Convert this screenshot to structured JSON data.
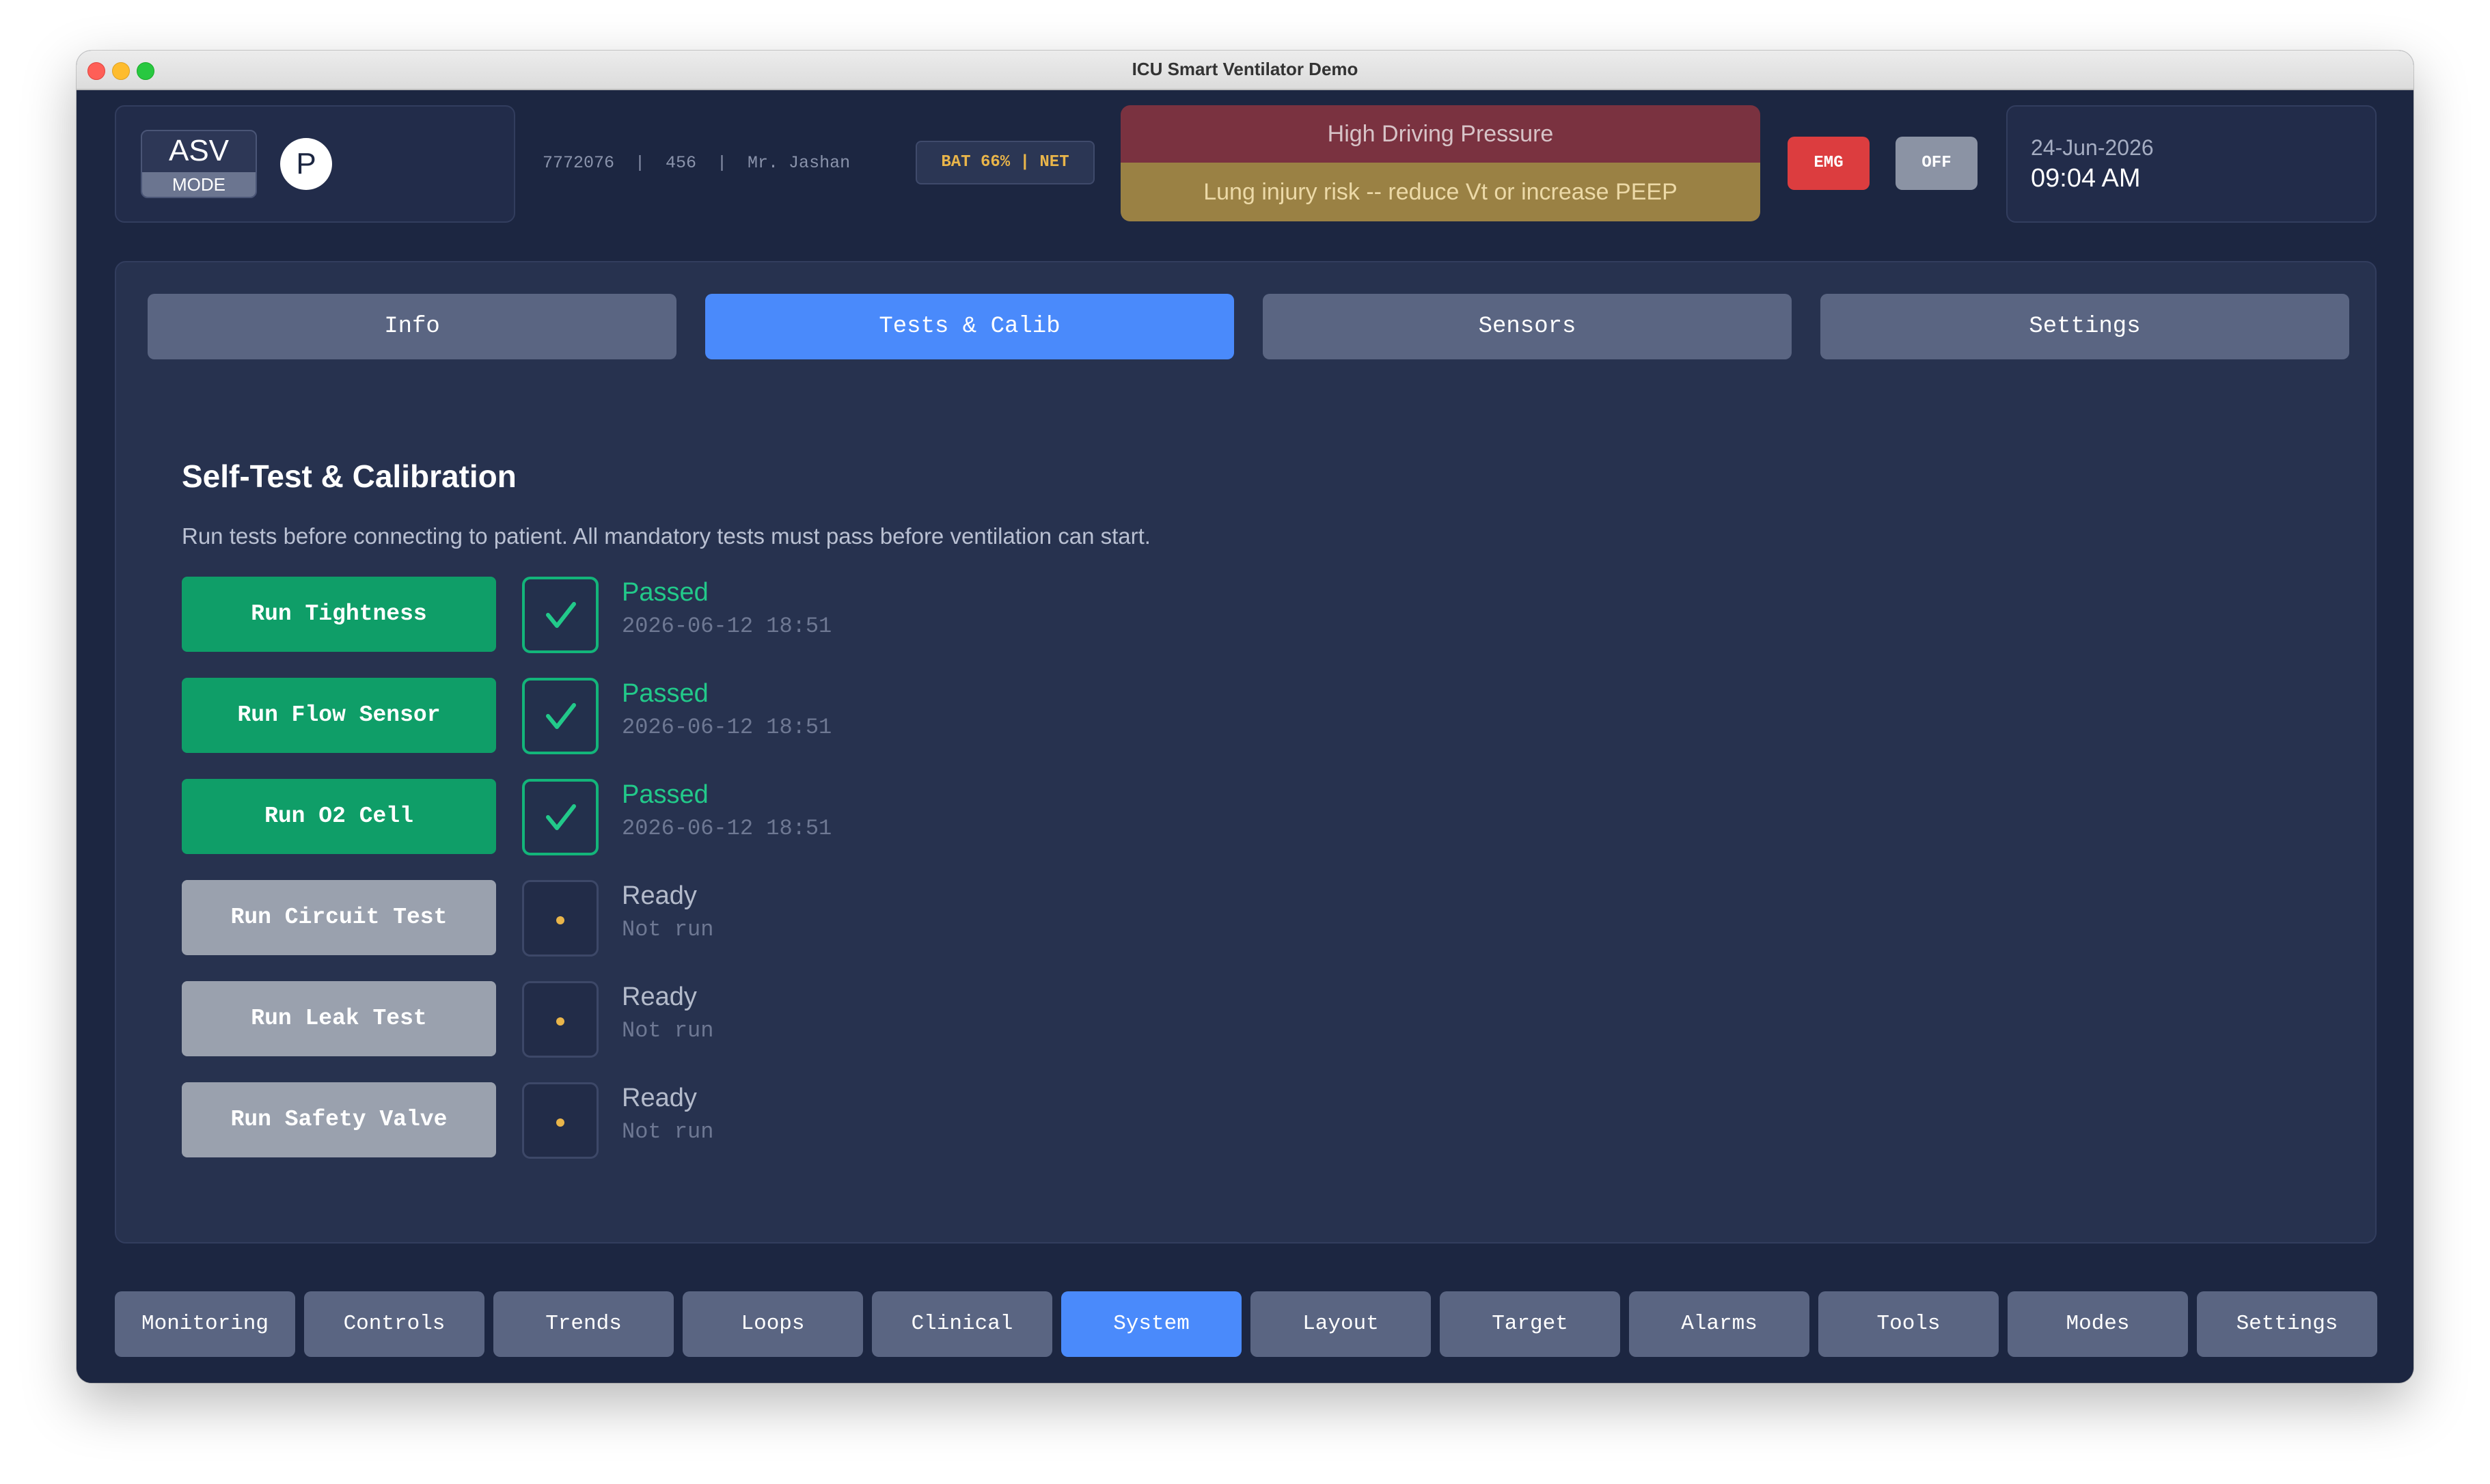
{
  "window": {
    "title": "ICU Smart Ventilator Demo"
  },
  "header": {
    "mode_name": "ASV",
    "mode_sub": "MODE",
    "patient_type": "P",
    "patient_info": "7772076  |  456  |  Mr. Jashan",
    "power_status": "BAT 66% | NET",
    "alarm_title": "High Driving Pressure",
    "alarm_message": "Lung injury risk -- reduce Vt or increase PEEP",
    "emg_label": "EMG",
    "off_label": "OFF",
    "date": "24-Jun-2026",
    "time": "09:04 AM"
  },
  "tabs": [
    {
      "label": "Info",
      "active": false
    },
    {
      "label": "Tests & Calib",
      "active": true
    },
    {
      "label": "Sensors",
      "active": false
    },
    {
      "label": "Settings",
      "active": false
    }
  ],
  "section": {
    "title": "Self-Test & Calibration",
    "description": "Run tests before connecting to patient. All mandatory tests must pass before ventilation can start."
  },
  "tests": [
    {
      "button": "Run Tightness",
      "status": "Passed",
      "time": "2026-06-12 18:51",
      "state": "passed"
    },
    {
      "button": "Run Flow Sensor",
      "status": "Passed",
      "time": "2026-06-12 18:51",
      "state": "passed"
    },
    {
      "button": "Run O2 Cell",
      "status": "Passed",
      "time": "2026-06-12 18:51",
      "state": "passed"
    },
    {
      "button": "Run Circuit Test",
      "status": "Ready",
      "time": "Not run",
      "state": "ready"
    },
    {
      "button": "Run Leak Test",
      "status": "Ready",
      "time": "Not run",
      "state": "ready"
    },
    {
      "button": "Run Safety Valve",
      "status": "Ready",
      "time": "Not run",
      "state": "ready"
    }
  ],
  "nav": [
    {
      "label": "Monitoring",
      "active": false
    },
    {
      "label": "Controls",
      "active": false
    },
    {
      "label": "Trends",
      "active": false
    },
    {
      "label": "Loops",
      "active": false
    },
    {
      "label": "Clinical",
      "active": false
    },
    {
      "label": "System",
      "active": true
    },
    {
      "label": "Layout",
      "active": false
    },
    {
      "label": "Target",
      "active": false
    },
    {
      "label": "Alarms",
      "active": false
    },
    {
      "label": "Tools",
      "active": false
    },
    {
      "label": "Modes",
      "active": false
    },
    {
      "label": "Settings",
      "active": false
    }
  ],
  "colors": {
    "accent": "#4a8afb",
    "passed": "#22c98a",
    "alarm_high": "#7a3240",
    "alarm_medium": "#9a8144",
    "emergency": "#dc3d3f"
  },
  "icons": {
    "passed": "checkmark-icon",
    "ready": "dot-icon"
  }
}
